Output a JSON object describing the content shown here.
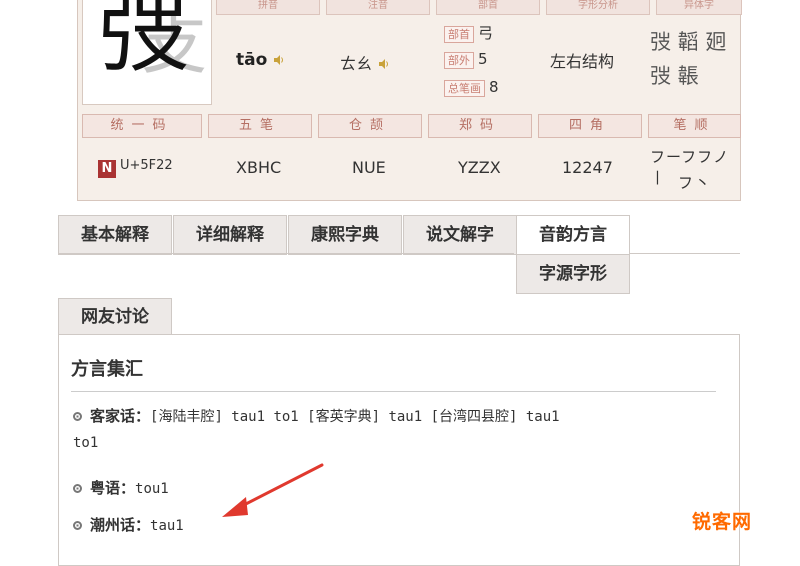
{
  "char_card": {
    "character": "弢",
    "top_headers": [
      "拼音",
      "注音",
      "部首",
      "字形分析",
      "异体字"
    ],
    "pinyin": "tāo",
    "zhuyin": "ㄊㄠ",
    "radical_tag": "部首",
    "radical_value": "弓",
    "outside_tag": "部外",
    "outside_value": "5",
    "total_tag": "总笔画",
    "total_value": "8",
    "structure": "左右结构",
    "variants_row1": "弢 韜 㢠",
    "variants_row2": "弢 韔",
    "bottom_headers": [
      "统一码",
      "五笔",
      "仓颉",
      "郑码",
      "四角",
      "笔顺"
    ],
    "unicode_logo": "N",
    "unicode": "U+5F22",
    "wubi": "XBHC",
    "cangjie": "NUE",
    "zhengma": "YZZX",
    "sijiao": "12247",
    "bishun_row1": "フーフフノ丨",
    "bishun_row2": "フ丶"
  },
  "tabs": [
    {
      "label": "基本解释"
    },
    {
      "label": "详细解释"
    },
    {
      "label": "康熙字典"
    },
    {
      "label": "说文解字"
    },
    {
      "label": "音韵方言"
    }
  ],
  "subtab": "字源字形",
  "discuss_tab": "网友讨论",
  "panel": {
    "title": "方言集汇",
    "entries": [
      {
        "label": "客家话：",
        "text": "[海陆丰腔] tau1 to1 [客英字典] tau1 [台湾四县腔] tau1",
        "text2": "to1"
      },
      {
        "label": "粤语：",
        "text": "tou1"
      },
      {
        "label": "潮州话：",
        "text": "tau1"
      }
    ]
  },
  "annotation_color": "#e0392e",
  "watermark": "锐客网"
}
